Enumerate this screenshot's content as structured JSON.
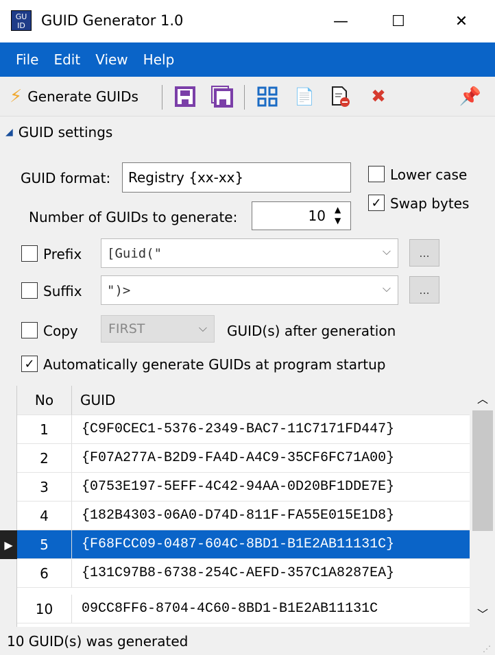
{
  "window": {
    "title": "GUID Generator 1.0",
    "icon_text": "GU ID",
    "minimize": "—",
    "maximize": "☐",
    "close": "✕"
  },
  "menu": [
    "File",
    "Edit",
    "View",
    "Help"
  ],
  "toolbar": {
    "generate_label": "Generate GUIDs",
    "icons": [
      "lightning-icon",
      "save-icon",
      "save-all-icon",
      "grid-icon",
      "copy-icon",
      "delete-doc-icon",
      "clear-icon",
      "pin-icon"
    ]
  },
  "settings": {
    "header": "GUID settings",
    "format_label": "GUID format:",
    "format_value": "Registry {xx-xx}",
    "count_label": "Number of GUIDs to generate:",
    "count_value": "10",
    "lower_case": {
      "label": "Lower case",
      "checked": false
    },
    "swap_bytes": {
      "label": "Swap bytes",
      "checked": true
    },
    "prefix": {
      "label": "Prefix",
      "checked": false,
      "value": "[Guid(\"",
      "button": "..."
    },
    "suffix": {
      "label": "Suffix",
      "checked": false,
      "value": "\")>",
      "button": "..."
    },
    "copy": {
      "label": "Copy",
      "checked": false,
      "value": "FIRST",
      "after": "GUID(s) after generation"
    },
    "auto": {
      "label": "Automatically generate GUIDs at program startup",
      "checked": true
    }
  },
  "grid": {
    "columns": [
      "No",
      "GUID"
    ],
    "rows": [
      {
        "no": "1",
        "guid": "{C9F0CEC1-5376-2349-BAC7-11C7171FD447}"
      },
      {
        "no": "2",
        "guid": "{F07A277A-B2D9-FA4D-A4C9-35CF6FC71A00}"
      },
      {
        "no": "3",
        "guid": "{0753E197-5EFF-4C42-94AA-0D20BF1DDE7E}"
      },
      {
        "no": "4",
        "guid": "{182B4303-06A0-D74D-811F-FA55E015E1D8}"
      },
      {
        "no": "5",
        "guid": "{F68FCC09-0487-604C-8BD1-B1E2AB11131C}",
        "selected": true
      },
      {
        "no": "6",
        "guid": "{131C97B8-6738-254C-AEFD-357C1A8287EA}"
      },
      {
        "no": "10",
        "guid": "09CC8FF6-8704-4C60-8BD1-B1E2AB11131C"
      }
    ],
    "selection_color": "#0a64c8"
  },
  "status": "10 GUID(s) was generated"
}
